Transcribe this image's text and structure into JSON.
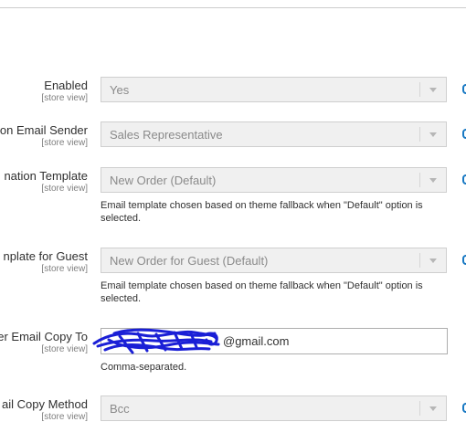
{
  "fields": [
    {
      "label": "Enabled",
      "scope": "[store view]",
      "value": "Yes"
    },
    {
      "label": "on Email Sender",
      "scope": "[store view]",
      "value": "Sales Representative"
    },
    {
      "label": "nation Template",
      "scope": "[store view]",
      "value": "New Order (Default)",
      "note": "Email template chosen based on theme fallback when \"Default\" option is selected."
    },
    {
      "label": "nplate for Guest",
      "scope": "[store view]",
      "value": "New Order for Guest (Default)",
      "note": "Email template chosen based on theme fallback when \"Default\" option is selected."
    },
    {
      "label": "er Email Copy To",
      "scope": "[store view]",
      "value": "@gmail.com",
      "note": "Comma-separated."
    },
    {
      "label": "ail Copy Method",
      "scope": "[store view]",
      "value": "Bcc"
    }
  ],
  "colors": {
    "accent": "#1979c3",
    "scribble": "#1a1fd6"
  },
  "icons": {
    "dropdown": "chevron-down-icon",
    "redaction": "scribble-redaction"
  }
}
